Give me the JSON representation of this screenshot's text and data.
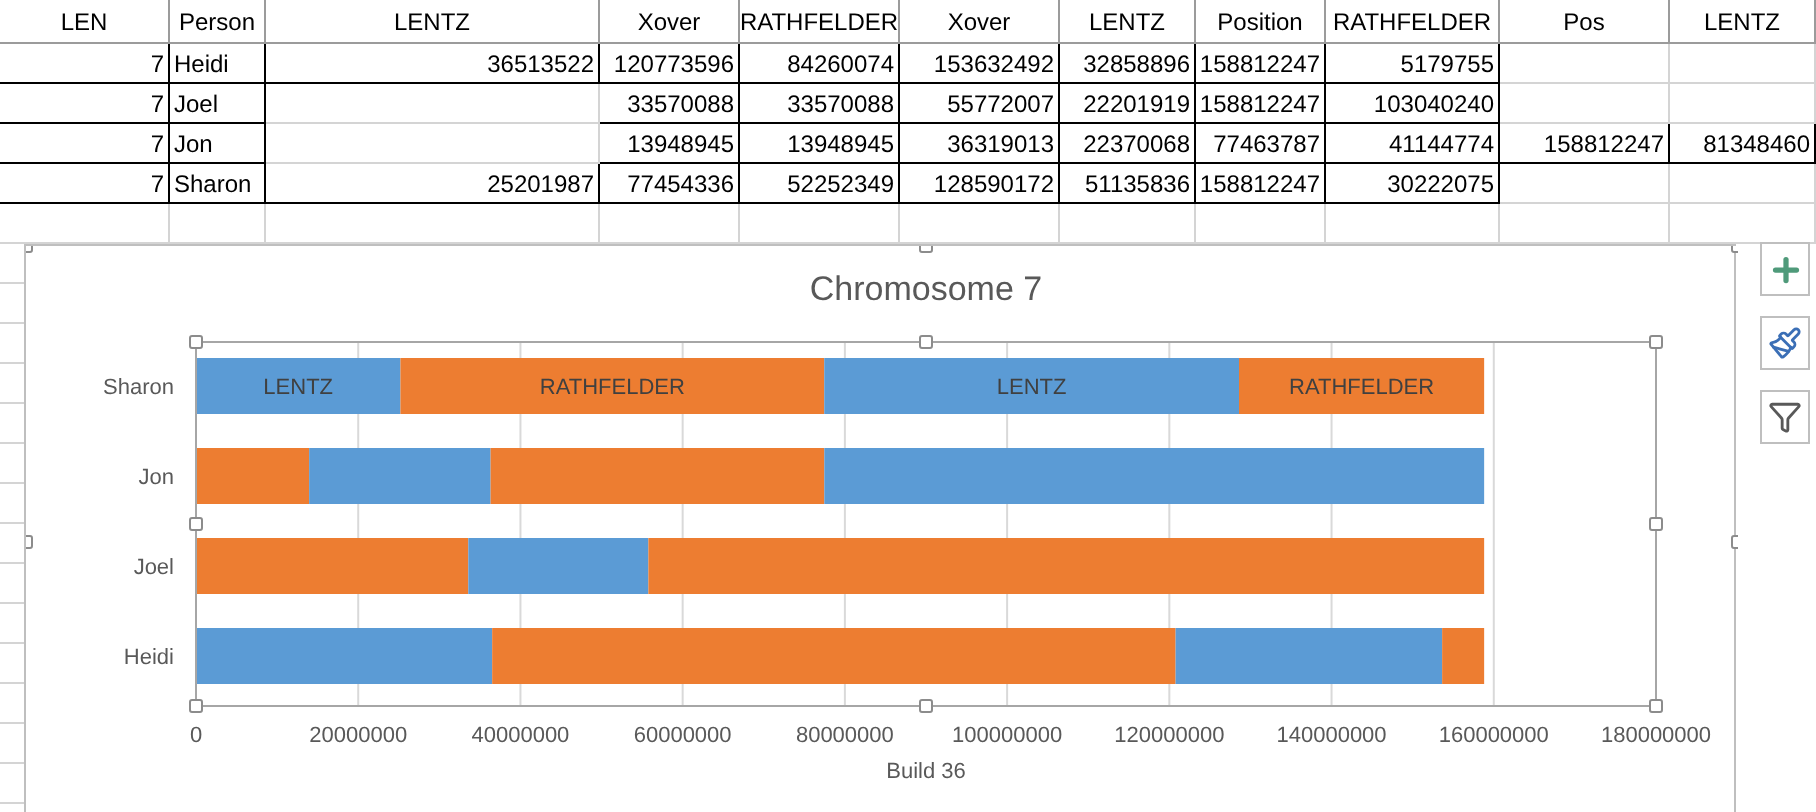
{
  "sheet": {
    "columns": [
      "LEN",
      "Person",
      "LENTZ",
      "Xover",
      "RATHFELDER",
      "Xover",
      "LENTZ",
      "Position",
      "RATHFELDER",
      "Pos",
      "LENTZ"
    ],
    "rows": [
      [
        "7",
        "Heidi",
        "36513522",
        "120773596",
        "84260074",
        "153632492",
        "32858896",
        "158812247",
        "5179755",
        null,
        null
      ],
      [
        "7",
        "Joel",
        null,
        "33570088",
        "33570088",
        "55772007",
        "22201919",
        "158812247",
        "103040240",
        null,
        null
      ],
      [
        "7",
        "Jon",
        null,
        "13948945",
        "13948945",
        "36319013",
        "22370068",
        "77463787",
        "41144774",
        "158812247",
        "81348460"
      ],
      [
        "7",
        "Sharon",
        "25201987",
        "77454336",
        "52252349",
        "128590172",
        "51135836",
        "158812247",
        "30222075",
        null,
        null
      ]
    ]
  },
  "chart": {
    "chart_data": {
      "type": "bar",
      "orientation": "horizontal",
      "stacked": true,
      "grid": true,
      "title": "Chromosome 7",
      "xlabel": "Build 36",
      "categories": [
        "Sharon",
        "Jon",
        "Joel",
        "Heidi"
      ],
      "series": [
        {
          "color": "#5b9bd5",
          "values": [
            25201987,
            null,
            null,
            36513522
          ],
          "value_labels": [
            "LENTZ",
            null,
            null,
            null
          ]
        },
        {
          "color": "#ed7d31",
          "values": [
            52252349,
            13948945,
            33570088,
            84260074
          ],
          "value_labels": [
            "RATHFELDER",
            null,
            null,
            null
          ]
        },
        {
          "color": "#5b9bd5",
          "values": [
            51135836,
            22370068,
            22201919,
            32858896
          ],
          "value_labels": [
            "LENTZ",
            null,
            null,
            null
          ]
        },
        {
          "color": "#ed7d31",
          "values": [
            30222075,
            41144774,
            103040240,
            5179755
          ],
          "value_labels": [
            "RATHFELDER",
            null,
            null,
            null
          ]
        },
        {
          "color": "#5b9bd5",
          "values": [
            null,
            81348460,
            null,
            null
          ]
        }
      ],
      "xlim": [
        0,
        180000000
      ],
      "xticks": [
        0,
        20000000,
        40000000,
        60000000,
        80000000,
        100000000,
        120000000,
        140000000,
        160000000,
        180000000
      ]
    }
  }
}
